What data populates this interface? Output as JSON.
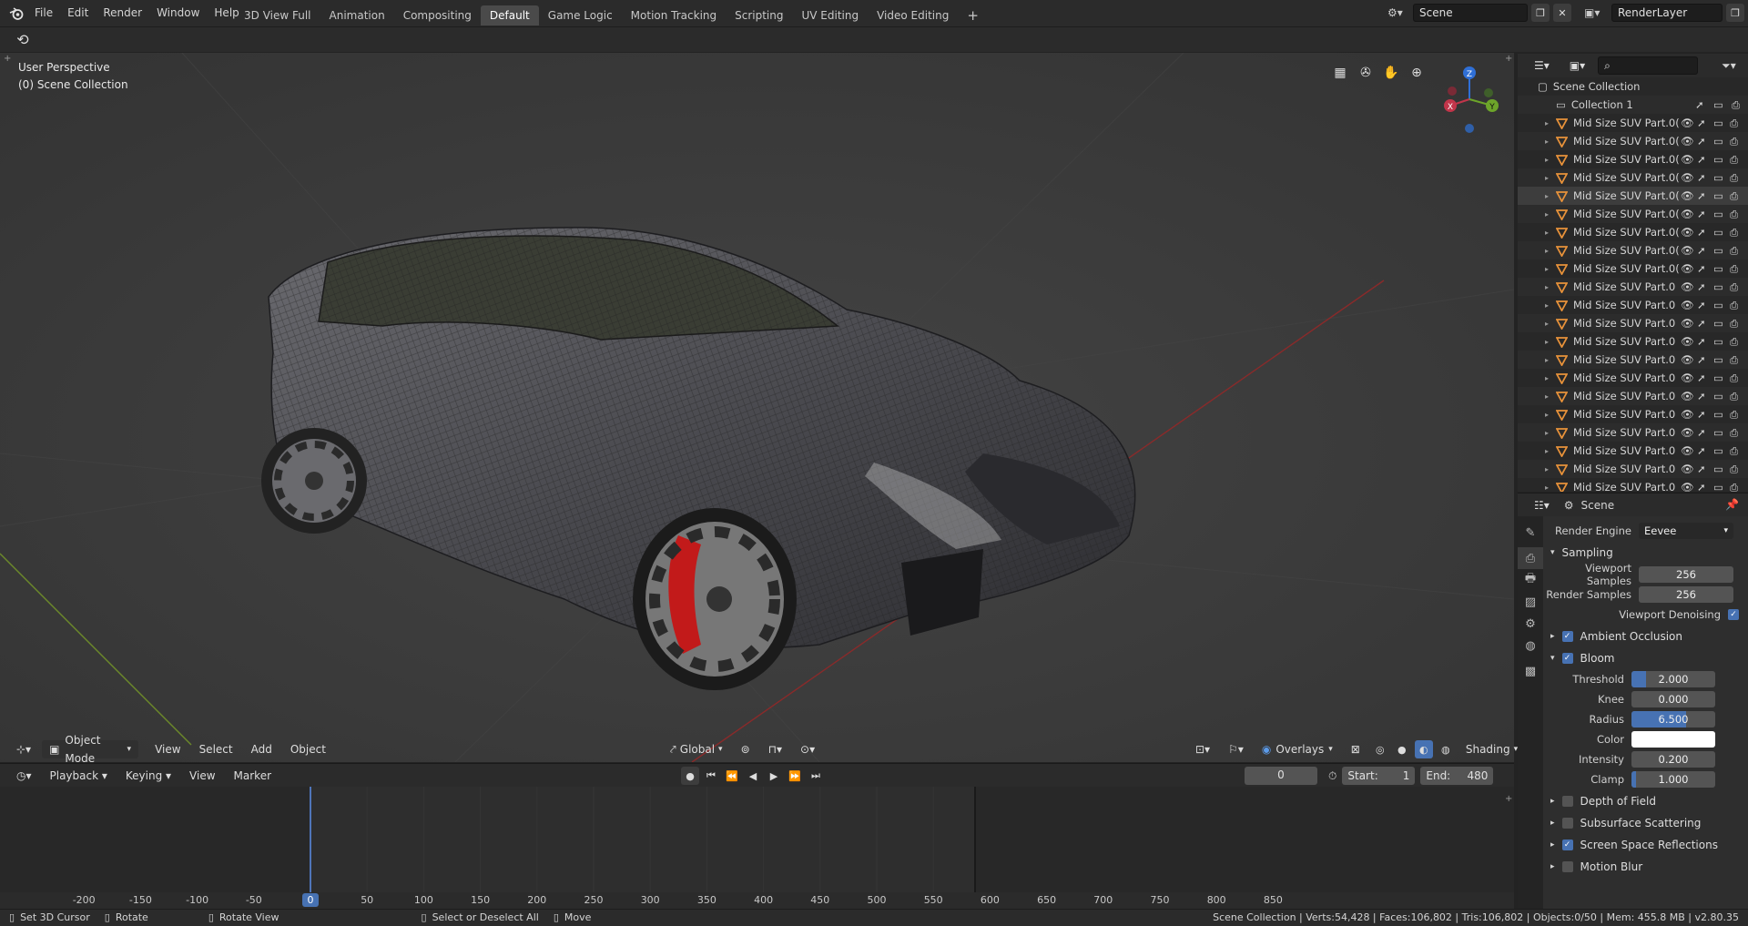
{
  "topbar": {
    "menus": [
      "File",
      "Edit",
      "Render",
      "Window",
      "Help"
    ],
    "workspaces": [
      "3D View Full",
      "Animation",
      "Compositing",
      "Default",
      "Game Logic",
      "Motion Tracking",
      "Scripting",
      "UV Editing",
      "Video Editing"
    ],
    "active_workspace": "Default",
    "add_tab": "+",
    "scene_name": "Scene",
    "render_layer": "RenderLayer"
  },
  "viewport": {
    "perspective_label": "User Perspective",
    "collection_label": "(0) Scene Collection",
    "mode": "Object Mode",
    "menus": [
      "View",
      "Select",
      "Add",
      "Object"
    ],
    "transform_orientation": "Global",
    "overlays": "Overlays",
    "shading": "Shading",
    "gizmo": {
      "z": "Z",
      "x": "X",
      "y": "Y"
    }
  },
  "timeline": {
    "menus": [
      "Playback",
      "Keying",
      "View",
      "Marker"
    ],
    "current_frame": "0",
    "start_label": "Start:",
    "start": "1",
    "end_label": "End:",
    "end": "480",
    "ruler": [
      "-200",
      "-150",
      "-100",
      "-50",
      "0",
      "50",
      "100",
      "150",
      "200",
      "250",
      "300",
      "350",
      "400",
      "450",
      "500",
      "550",
      "600",
      "650",
      "700",
      "750",
      "800",
      "850"
    ]
  },
  "statusbar": {
    "items": [
      "Set 3D Cursor",
      "Rotate",
      "Rotate View",
      "Select or Deselect All",
      "Move"
    ],
    "stats": "Scene Collection | Verts:54,428 | Faces:106,802 | Tris:106,802 | Objects:0/50 | Mem: 455.8 MB | v2.80.35"
  },
  "outliner": {
    "root": "Scene Collection",
    "collection": "Collection 1",
    "objects": [
      "Mid Size SUV Part.0(",
      "Mid Size SUV Part.0(",
      "Mid Size SUV Part.0(",
      "Mid Size SUV Part.0(",
      "Mid Size SUV Part.0(",
      "Mid Size SUV Part.0(",
      "Mid Size SUV Part.0(",
      "Mid Size SUV Part.0(",
      "Mid Size SUV Part.0(",
      "Mid Size SUV Part.0",
      "Mid Size SUV Part.0",
      "Mid Size SUV Part.0",
      "Mid Size SUV Part.0",
      "Mid Size SUV Part.0",
      "Mid Size SUV Part.0",
      "Mid Size SUV Part.0",
      "Mid Size SUV Part.0",
      "Mid Size SUV Part.0",
      "Mid Size SUV Part.0",
      "Mid Size SUV Part.0",
      "Mid Size SUV Part.0"
    ]
  },
  "properties": {
    "header": "Scene",
    "render_engine_label": "Render Engine",
    "render_engine": "Eevee",
    "sampling": "Sampling",
    "viewport_samples_label": "Viewport Samples",
    "viewport_samples": "256",
    "render_samples_label": "Render Samples",
    "render_samples": "256",
    "viewport_denoising": "Viewport Denoising",
    "ambient_occlusion": "Ambient Occlusion",
    "bloom": "Bloom",
    "threshold_label": "Threshold",
    "threshold": "2.000",
    "knee_label": "Knee",
    "knee": "0.000",
    "radius_label": "Radius",
    "radius": "6.500",
    "color_label": "Color",
    "intensity_label": "Intensity",
    "intensity": "0.200",
    "clamp_label": "Clamp",
    "clamp": "1.000",
    "depth_of_field": "Depth of Field",
    "subsurface": "Subsurface Scattering",
    "ssr": "Screen Space Reflections",
    "motion_blur": "Motion Blur"
  },
  "colors": {
    "accent": "#4772b3",
    "viewport_bg": "#3b3b3b",
    "object_icon": "#e8923a"
  }
}
